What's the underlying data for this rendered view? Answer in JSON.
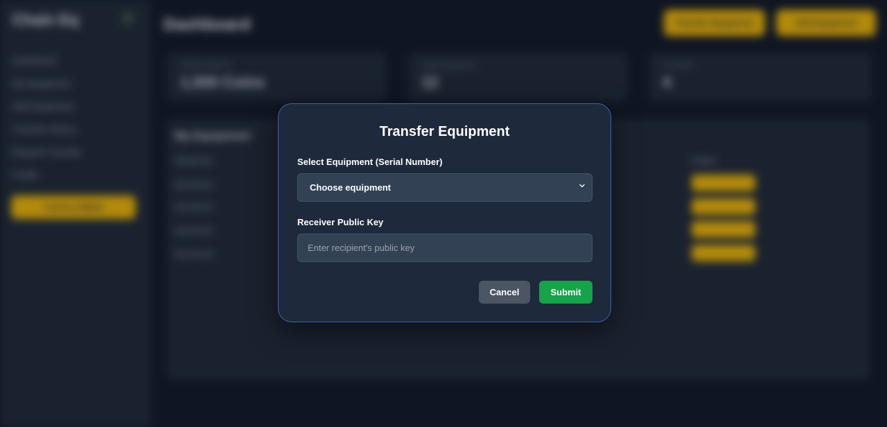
{
  "background": {
    "sidebar": {
      "logo": "Chain Eq",
      "nav_items": [
        "Dashboard",
        "My Equipment",
        "Add Equipment",
        "Transfer History",
        "Request Transfer",
        "Profile"
      ],
      "cta_label": "Connect Wallet"
    },
    "header": {
      "title": "Dashboard",
      "buttons": [
        "Transfer Equipment",
        "Add Equipment"
      ]
    },
    "stats": [
      {
        "label": "Wallet Balance",
        "value": "1,500 Coins"
      },
      {
        "label": "Total Equipment",
        "value": "12"
      },
      {
        "label": "Transfers",
        "value": "4"
      }
    ],
    "table": {
      "title": "My Equipment",
      "columns": [
        "Serial No.",
        "Action"
      ],
      "rows": [
        "EQ-00123",
        "EQ-00124",
        "EQ-00125",
        "EQ-00126"
      ]
    }
  },
  "modal": {
    "title": "Transfer Equipment",
    "equipment_label": "Select Equipment (Serial Number)",
    "equipment_selected": "Choose equipment",
    "key_label": "Receiver Public Key",
    "key_placeholder": "Enter recipient's public key",
    "key_value": "",
    "cancel_label": "Cancel",
    "submit_label": "Submit"
  },
  "colors": {
    "accent": "#eab308",
    "submit": "#16a34a",
    "cancel": "#4b5563",
    "modal_border": "#3b63b8"
  }
}
